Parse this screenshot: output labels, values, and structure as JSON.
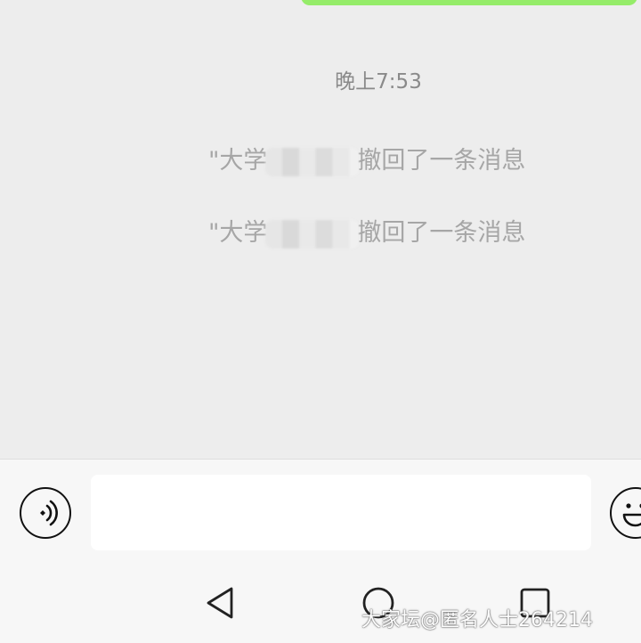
{
  "chat": {
    "timestamp": "晚上7:53",
    "recall_notices": [
      {
        "prefix": "\"大学",
        "suffix": "撤回了一条消息"
      },
      {
        "prefix": "\"大学",
        "suffix": "撤回了一条消息"
      }
    ]
  },
  "input_bar": {
    "message_value": "",
    "voice_icon": "voice-icon",
    "emoji_icon": "emoji-icon"
  },
  "nav": {
    "back_icon": "back-triangle-icon",
    "home_icon": "home-circle-icon",
    "recent_icon": "recent-square-icon"
  },
  "watermark": "大家坛@匿名人士264214",
  "colors": {
    "chat_background": "#ededed",
    "sent_bubble": "#95ec69",
    "recall_text": "#a6a6a6",
    "timestamp_text": "#8a8a8a",
    "input_bar_background": "#f7f7f7"
  }
}
